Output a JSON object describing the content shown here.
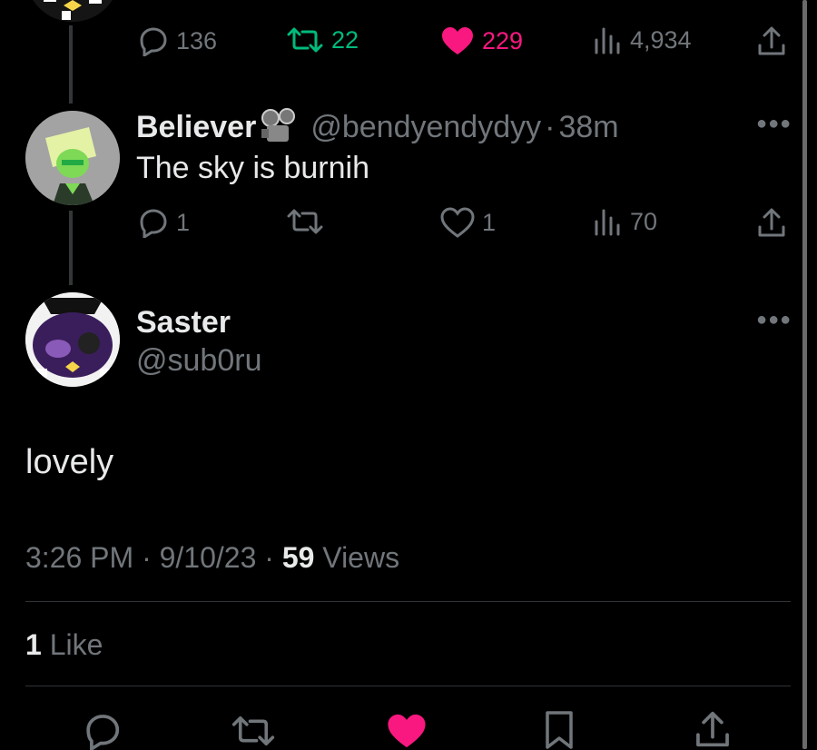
{
  "prev_tweet": {
    "actions": {
      "replies": "136",
      "retweets": "22",
      "likes": "229",
      "views": "4,934"
    },
    "colors": {
      "retweet_active": "#00ba7c",
      "like_active": "#f91880"
    }
  },
  "reply_tweet": {
    "display_name": "Believer",
    "badge_icon": "projector-emoji-icon",
    "handle": "@bendyendydyy",
    "separator": "·",
    "time": "38m",
    "text": "The sky is burnih",
    "actions": {
      "replies": "1",
      "retweets": "",
      "likes": "1",
      "views": "70"
    }
  },
  "main_tweet": {
    "display_name": "Saster",
    "handle": "@sub0ru",
    "text": "lovely",
    "time": "3:26 PM",
    "date": "9/10/23",
    "sep1": "·",
    "sep2": "·",
    "views_count": "59",
    "views_label": "Views",
    "likes_count": "1",
    "likes_label": "Like"
  },
  "action_bar": {
    "icons": [
      "reply-icon",
      "retweet-icon",
      "like-icon",
      "bookmark-icon",
      "share-icon"
    ],
    "like_color": "#f91880"
  }
}
